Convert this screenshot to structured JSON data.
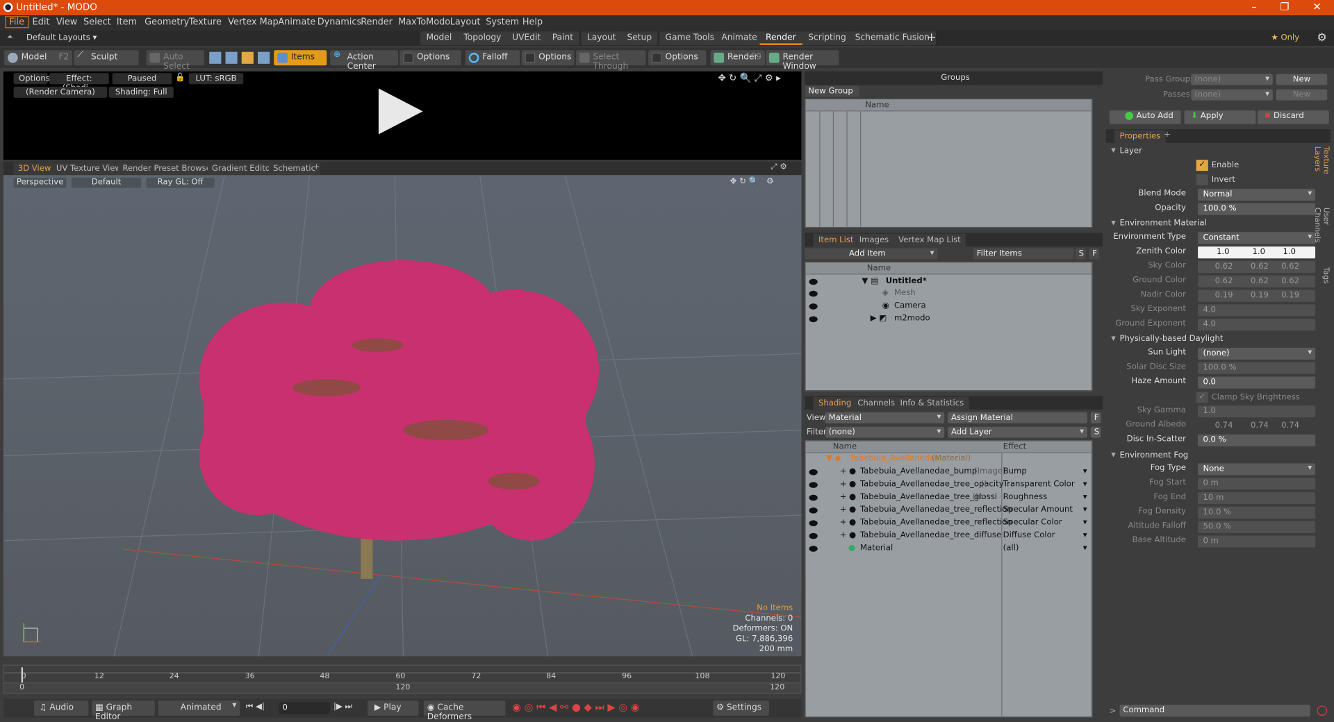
{
  "window": {
    "title": "Untitled* - MODO",
    "min": "–",
    "max": "❐",
    "close": "✕"
  },
  "menu": [
    "File",
    "Edit",
    "View",
    "Select",
    "Item",
    "Geometry",
    "Texture",
    "Vertex Map",
    "Animate",
    "Dynamics",
    "Render",
    "MaxToModo",
    "Layout",
    "System",
    "Help"
  ],
  "layouts": {
    "label": "Default Layouts ▾",
    "tabs": [
      "Model",
      "Topology",
      "UVEdit",
      "Paint",
      "Layout",
      "Setup",
      "Game Tools",
      "Animate",
      "Render",
      "Scripting",
      "Schematic Fusion"
    ],
    "active": "Render",
    "only": "★ Only"
  },
  "toolbar": {
    "model": "Model",
    "model_key": "F2",
    "sculpt": "Sculpt",
    "auto_select": "Auto Select",
    "items": "Items",
    "action_center": "Action Center",
    "options1": "Options",
    "falloff": "Falloff",
    "options2": "Options",
    "select_through": "Select Through",
    "options3": "Options",
    "render": "Render",
    "render_key": "F9",
    "render_window": "Render Window"
  },
  "preview": {
    "options": "Options",
    "effect": "Effect: (Shadi...",
    "paused": "Paused",
    "lut": "LUT: sRGB",
    "camera": "(Render Camera)",
    "shading": "Shading: Full"
  },
  "viewtabs": [
    "3D View",
    "UV Texture View",
    "Render Preset Browser",
    "Gradient Editor",
    "Schematic"
  ],
  "viewport": {
    "perspective": "Perspective",
    "default": "Default",
    "raygl": "Ray GL: Off",
    "info": {
      "noitems": "No Items",
      "channels": "Channels: 0",
      "deformers": "Deformers: ON",
      "gl": "GL: 7,886,396",
      "scale": "200 mm"
    }
  },
  "timeline": {
    "ticks": [
      "0",
      "12",
      "24",
      "36",
      "48",
      "60",
      "72",
      "84",
      "96",
      "108",
      "120"
    ],
    "sub_left": "0",
    "sub_mid": "120",
    "sub_right": "120"
  },
  "bottom": {
    "audio": "Audio",
    "graph": "Graph Editor",
    "animated": "Animated",
    "frame": "0",
    "play": "Play",
    "cache": "Cache Deformers",
    "settings": "Settings"
  },
  "groups": {
    "title": "Groups",
    "new_group": "New Group",
    "name_col": "Name"
  },
  "itemlist": {
    "tabs": [
      "Item List",
      "Images",
      "Vertex Map List"
    ],
    "add_item": "Add Item",
    "filter": "Filter Items",
    "s": "S",
    "f": "F",
    "name_col": "Name",
    "items": [
      {
        "name": "Untitled*",
        "bold": true
      },
      {
        "name": "Mesh",
        "dim": true
      },
      {
        "name": "Camera"
      },
      {
        "name": "m2modo"
      }
    ]
  },
  "shading": {
    "tabs": [
      "Shading",
      "Channels",
      "Info & Statistics"
    ],
    "view_label": "View",
    "view_value": "Material",
    "assign": "Assign Material",
    "filter_label": "Filter",
    "filter_value": "(none)",
    "add_layer": "Add Layer",
    "f": "F",
    "s": "S",
    "col_name": "Name",
    "col_effect": "Effect",
    "root": {
      "name": "Tabebuia_Avellanedae",
      "suffix": "(Material)"
    },
    "rows": [
      {
        "name": "Tabebuia_Avellanedae_bump",
        "suffix": "(Image)",
        "effect": "Bump"
      },
      {
        "name": "Tabebuia_Avellanedae_tree_opacity",
        "suffix": "(I...",
        "effect": "Transparent Color"
      },
      {
        "name": "Tabebuia_Avellanedae_tree_glossi",
        "suffix": "(Im...",
        "effect": "Roughness"
      },
      {
        "name": "Tabebuia_Avellanedae_tree_reflection",
        "suffix": "",
        "effect": "Specular Amount"
      },
      {
        "name": "Tabebuia_Avellanedae_tree_reflection",
        "suffix": "",
        "effect": "Specular Color"
      },
      {
        "name": "Tabebuia_Avellanedae_tree_diffuse",
        "suffix": "(I...",
        "effect": "Diffuse Color"
      },
      {
        "name": "Material",
        "suffix": "",
        "effect": "(all)"
      }
    ]
  },
  "passes": {
    "pass_groups": "Pass Groups",
    "passes": "Passes",
    "none": "(none)",
    "new": "New",
    "auto_add": "Auto Add",
    "apply": "Apply",
    "discard": "Discard"
  },
  "properties": {
    "tab": "Properties",
    "layer": "Layer",
    "enable": "Enable",
    "invert": "Invert",
    "blend_mode": "Blend Mode",
    "blend_value": "Normal",
    "opacity": "Opacity",
    "opacity_value": "100.0 %",
    "env_material": "Environment Material",
    "env_type": "Environment Type",
    "env_type_value": "Constant",
    "zenith": "Zenith Color",
    "zenith_vals": [
      "1.0",
      "1.0",
      "1.0"
    ],
    "sky": "Sky Color",
    "sky_vals": [
      "0.62",
      "0.62",
      "0.62"
    ],
    "ground": "Ground Color",
    "ground_vals": [
      "0.62",
      "0.62",
      "0.62"
    ],
    "nadir": "Nadir Color",
    "nadir_vals": [
      "0.19",
      "0.19",
      "0.19"
    ],
    "sky_exp": "Sky Exponent",
    "sky_exp_val": "4.0",
    "ground_exp": "Ground Exponent",
    "ground_exp_val": "4.0",
    "daylight": "Physically-based Daylight",
    "sun": "Sun Light",
    "sun_val": "(none)",
    "solar": "Solar Disc Size",
    "solar_val": "100.0 %",
    "haze": "Haze Amount",
    "haze_val": "0.0",
    "clamp": "Clamp Sky Brightness",
    "gamma": "Sky Gamma",
    "gamma_val": "1.0",
    "albedo": "Ground Albedo",
    "albedo_vals": [
      "0.74",
      "0.74",
      "0.74"
    ],
    "disc": "Disc In-Scatter",
    "disc_val": "0.0 %",
    "fog": "Environment Fog",
    "fog_type": "Fog Type",
    "fog_type_val": "None",
    "fog_start": "Fog Start",
    "fog_start_val": "0 m",
    "fog_end": "Fog End",
    "fog_end_val": "10 m",
    "fog_density": "Fog Density",
    "fog_density_val": "10.0 %",
    "alt_falloff": "Altitude Falloff",
    "alt_falloff_val": "50.0 %",
    "base_alt": "Base Altitude",
    "base_alt_val": "0 m"
  },
  "sidetabs": [
    "Texture Layers",
    "User Channels",
    "Tags"
  ],
  "command": "Command"
}
